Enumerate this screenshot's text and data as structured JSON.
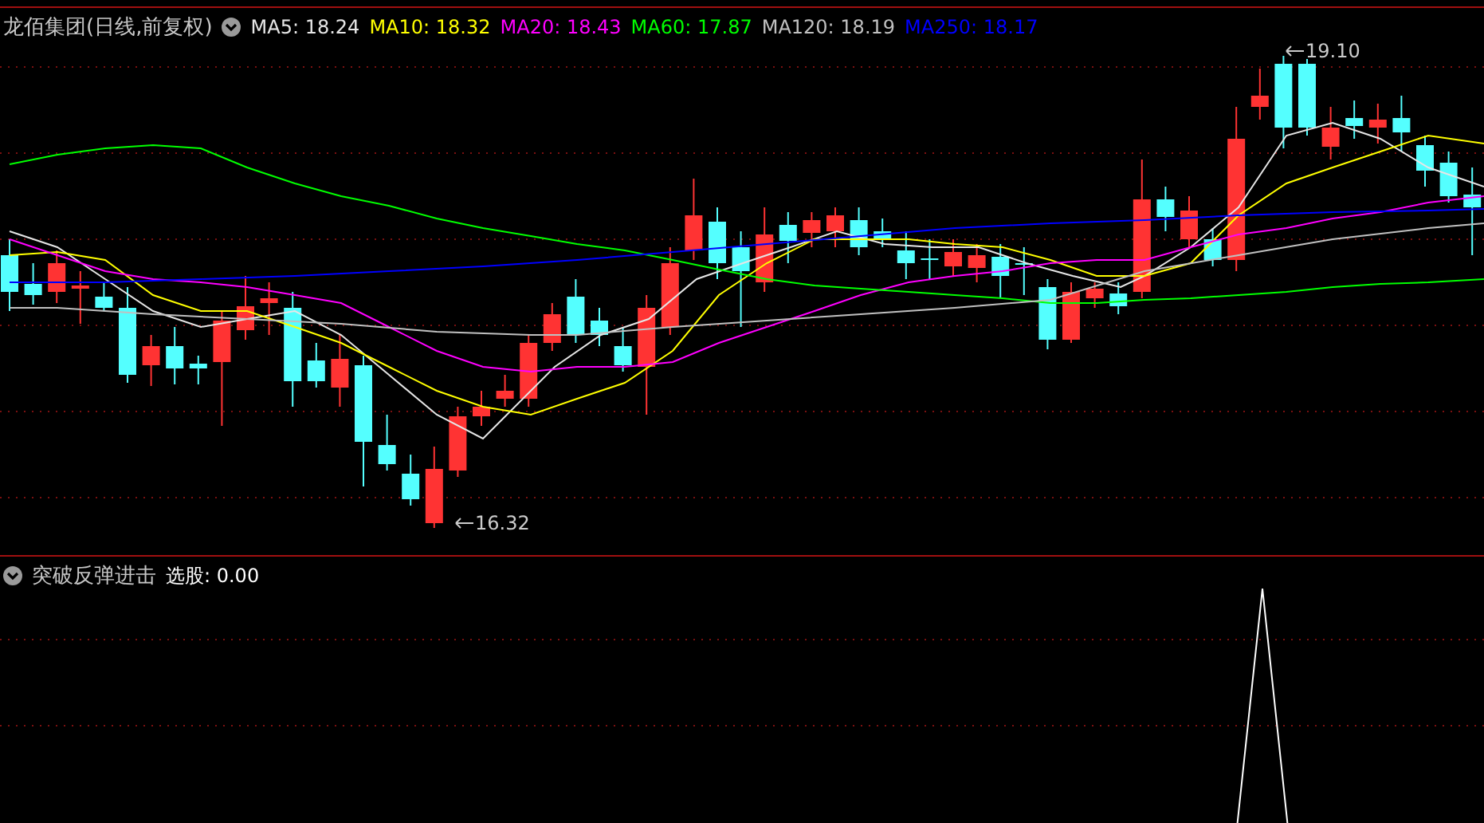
{
  "main_chart": {
    "title": "龙佰集团(日线,前复权)",
    "legend": [
      {
        "label": "MA5: 18.24",
        "color": "#e6e6e6"
      },
      {
        "label": "MA10: 18.32",
        "color": "#ffff00"
      },
      {
        "label": "MA20: 18.43",
        "color": "#ff00ff"
      },
      {
        "label": "MA60: 17.87",
        "color": "#00ff00"
      },
      {
        "label": "MA120: 18.19",
        "color": "#c0c0c0"
      },
      {
        "label": "MA250: 18.17",
        "color": "#0000ff"
      }
    ],
    "high_marker": "19.10",
    "low_marker": "16.32"
  },
  "indicator_panel": {
    "title": "突破反弹进击",
    "reading": "选股: 0.00"
  }
}
